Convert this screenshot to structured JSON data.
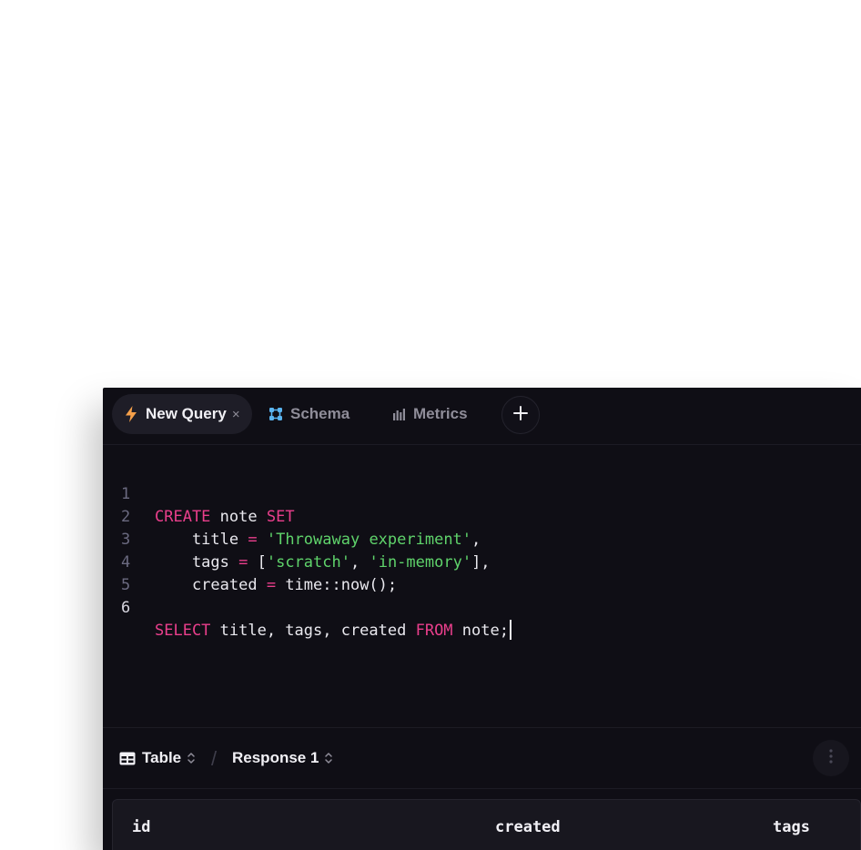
{
  "tabs": [
    {
      "label": "New Query",
      "icon": "lightning-icon",
      "active": true,
      "closable": true,
      "close_glyph": "×"
    },
    {
      "label": "Schema",
      "icon": "schema-icon",
      "active": false
    },
    {
      "label": "Metrics",
      "icon": "bar-chart-icon",
      "active": false
    }
  ],
  "add_tab": {
    "icon": "plus-icon"
  },
  "editor": {
    "line_numbers": [
      "1",
      "2",
      "3",
      "4",
      "5",
      "6"
    ],
    "tokens": {
      "l1_kw1": "CREATE",
      "l1_t1": " note ",
      "l1_kw2": "SET",
      "l2_t1": "    title ",
      "l2_op": "=",
      "l2_t2": " ",
      "l2_str": "'Throwaway experiment'",
      "l2_t3": ",",
      "l3_t1": "    tags ",
      "l3_op": "=",
      "l3_t2": " [",
      "l3_str1": "'scratch'",
      "l3_t3": ", ",
      "l3_str2": "'in-memory'",
      "l3_t4": "],",
      "l4_t1": "    created ",
      "l4_op": "=",
      "l4_t2": " time::now();",
      "l6_kw1": "SELECT",
      "l6_t1": " title, tags, created ",
      "l6_kw2": "FROM",
      "l6_t2": " note;"
    }
  },
  "results": {
    "mode_label": "Table",
    "separator": "/",
    "response_label": "Response 1",
    "columns": [
      "id",
      "created",
      "tags"
    ]
  },
  "colors": {
    "background": "#0f0e15",
    "keyword": "#ea3f8c",
    "string": "#5fd36b",
    "lightning": "#f5a04a",
    "schema_accent": "#5ab4f0"
  }
}
